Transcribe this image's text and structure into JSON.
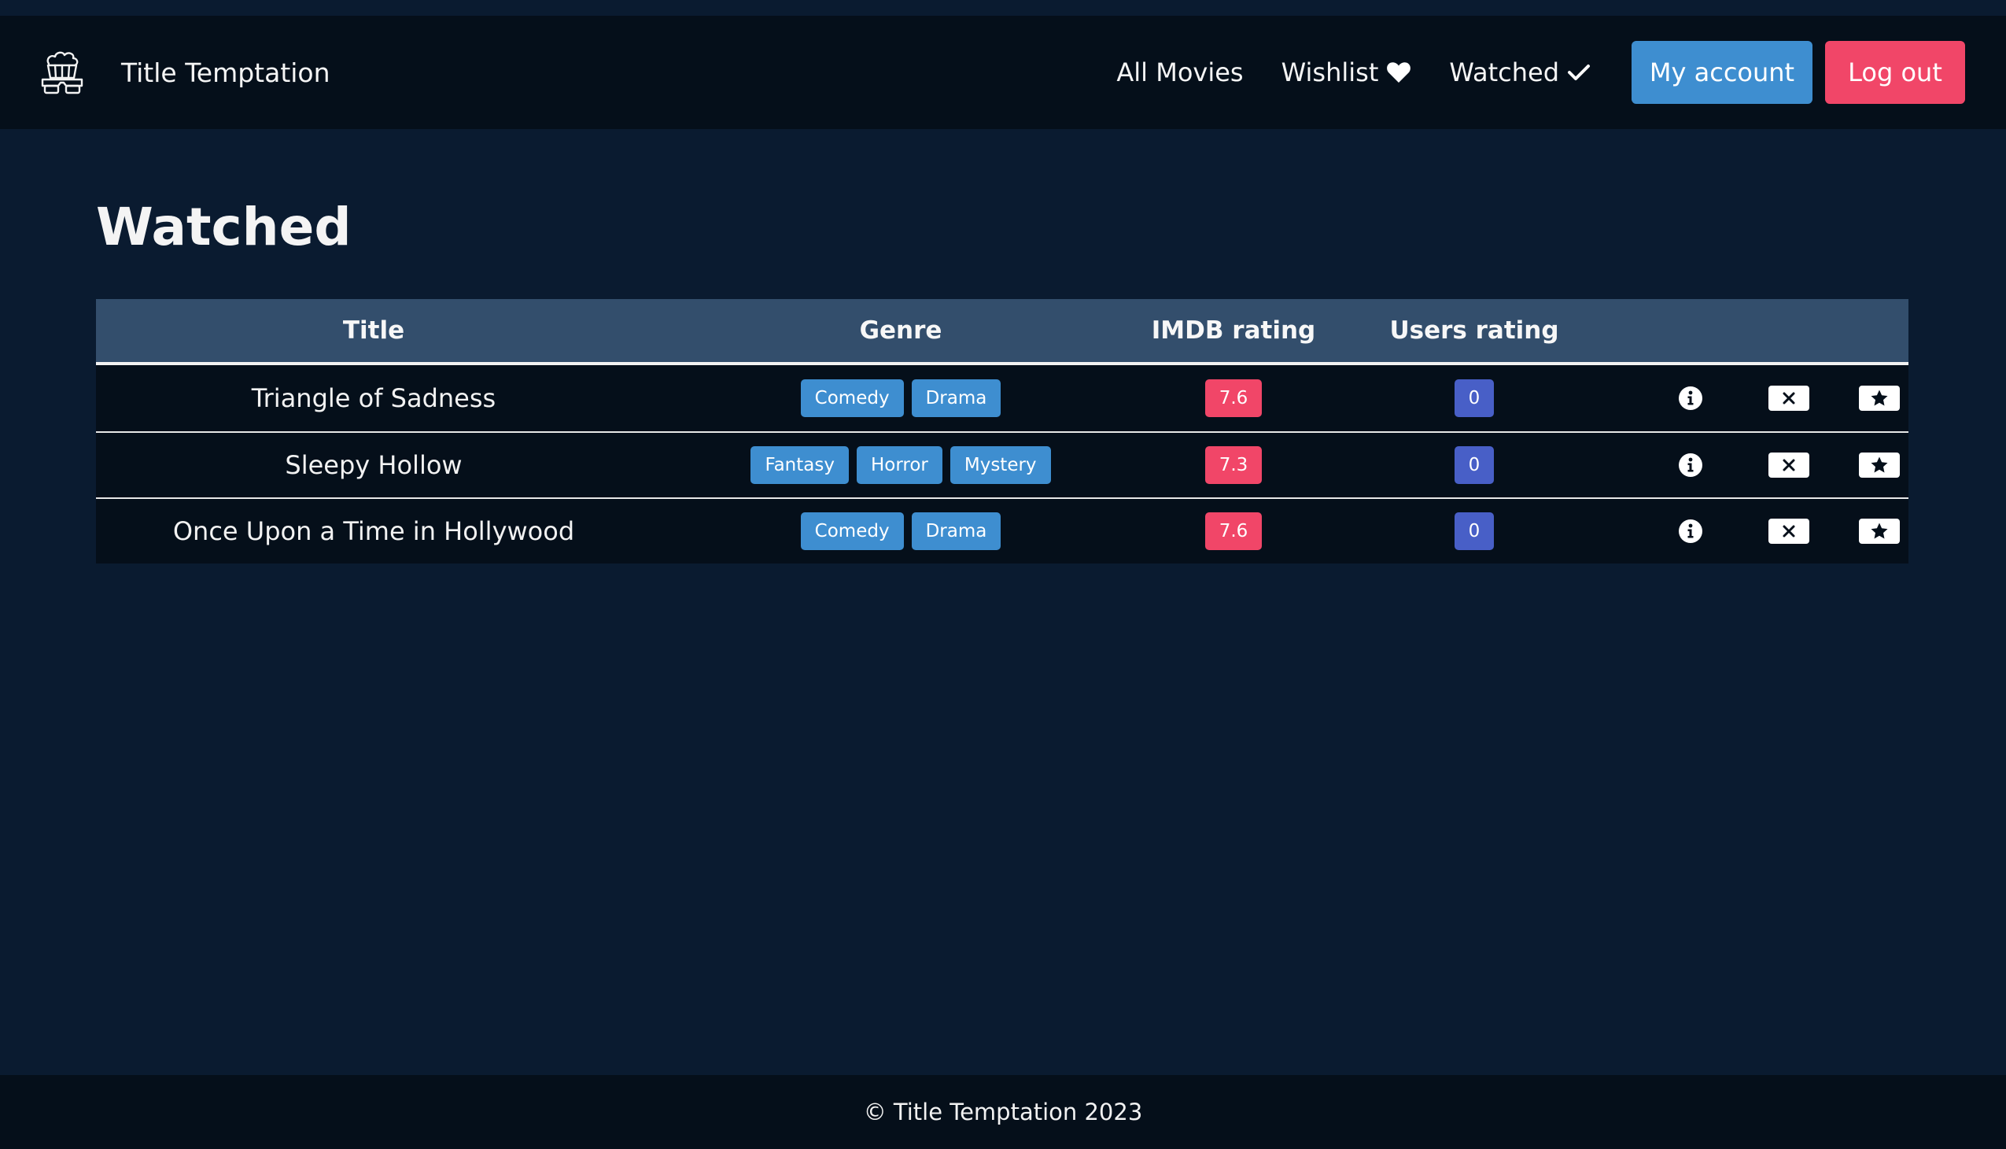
{
  "navbar": {
    "brand_title": "Title Temptation",
    "logo_icon": "popcorn-3d-glasses-icon",
    "links": {
      "all_movies": "All Movies",
      "wishlist": "Wishlist",
      "watched": "Watched"
    },
    "my_account": "My account",
    "log_out": "Log out"
  },
  "page": {
    "title": "Watched"
  },
  "table": {
    "headers": {
      "title": "Title",
      "genre": "Genre",
      "imdb": "IMDB rating",
      "users": "Users rating"
    },
    "rows": [
      {
        "title": "Triangle of Sadness",
        "genres": [
          "Comedy",
          "Drama"
        ],
        "imdb": "7.6",
        "users": "0"
      },
      {
        "title": "Sleepy Hollow",
        "genres": [
          "Fantasy",
          "Horror",
          "Mystery"
        ],
        "imdb": "7.3",
        "users": "0"
      },
      {
        "title": "Once Upon a Time in Hollywood",
        "genres": [
          "Comedy",
          "Drama"
        ],
        "imdb": "7.6",
        "users": "0"
      }
    ]
  },
  "footer": {
    "text": "© Title Temptation 2023"
  },
  "colors": {
    "background": "#0a1b30",
    "navbar": "#050f1a",
    "table_header": "#334e6c",
    "info_button": "#3e8ed0",
    "danger": "#f14668",
    "link_blue": "#485fc7"
  },
  "icons": {
    "wishlist": "heart-icon",
    "watched": "check-icon",
    "info": "info-circle-icon",
    "remove": "close-icon",
    "rate": "star-icon"
  }
}
